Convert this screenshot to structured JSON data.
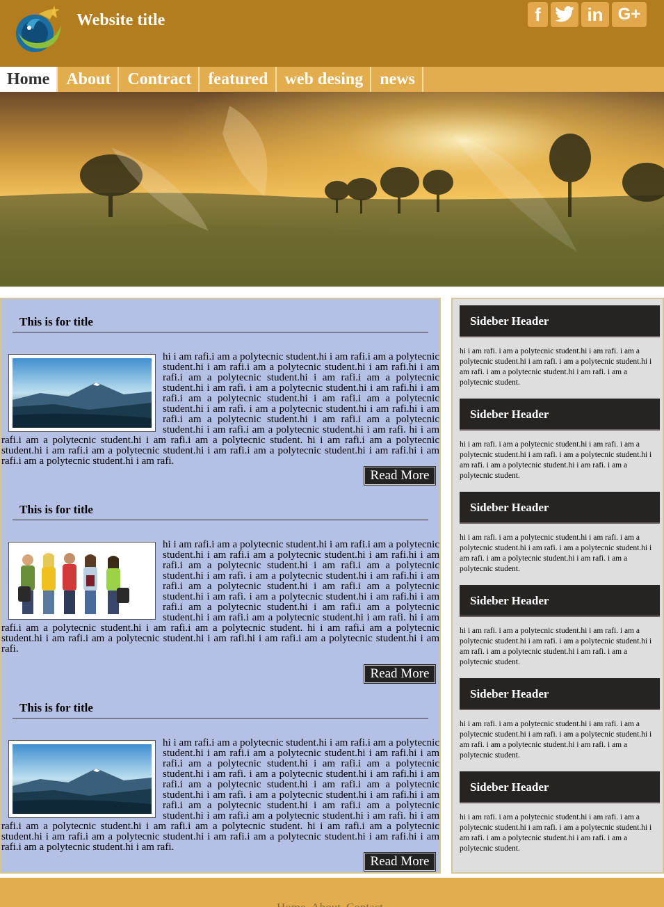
{
  "header": {
    "title": "Website title",
    "social": [
      "facebook-icon",
      "twitter-icon",
      "linkedin-icon",
      "google-plus-icon"
    ],
    "social_glyphs": {
      "facebook": "f",
      "twitter": "t",
      "linkedin": "in",
      "gplus": "G+"
    }
  },
  "nav": {
    "items": [
      {
        "label": "Home"
      },
      {
        "label": "About"
      },
      {
        "label": "Contract"
      },
      {
        "label": "featured"
      },
      {
        "label": "web desing"
      },
      {
        "label": "news"
      }
    ]
  },
  "articles": [
    {
      "title": "This is for title",
      "image": "mountain-landscape",
      "body": "hi i am rafi.i am a polytecnic student.hi i am rafi.i am a polytecnic student.hi i am rafi.i am a polytecnic student.hi i am rafi.hi i am rafi.i am a polytecnic student.hi i am rafi.i am a polytecnic student.hi i am rafi. i am a polytecnic student.hi i am rafi.hi i am rafi.i am a polytecnic student.hi i am rafi.i am a polytecnic student.hi i am rafi. i am a polytecnic student.hi i am rafi.hi i am rafi.i am a polytecnic student.hi i am rafi.i am a polytecnic student.hi i am rafi.i am a polytecnic student.hi i am rafi. hi i am rafi.i am a polytecnic student.hi i am rafi.i am a polytecnic student. hi i am rafi.i am a polytecnic student.hi i am rafi.i am a polytecnic student.hi i am rafi.i am a polytecnic student.hi i am rafi.hi i am rafi.i am a polytecnic student.hi i am rafi.",
      "read_more": "Read More"
    },
    {
      "title": "This is for title",
      "image": "students-group",
      "body": "hi i am rafi.i am a polytecnic student.hi i am rafi.i am a polytecnic student.hi i am rafi.i am a polytecnic student.hi i am rafi.hi i am rafi.i am a polytecnic student.hi i am rafi.i am a polytecnic student.hi i am rafi. i am a polytecnic student.hi i am rafi.hi i am rafi.i am a polytecnic student.hi i am rafi.i am a polytecnic student.hi i am rafi. i am a polytecnic student.hi i am rafi.hi i am rafi.i am a polytecnic student.hi i am rafi.i am a polytecnic student.hi i am rafi.i am a polytecnic student.hi i am rafi. hi i am rafi.i am a polytecnic student.hi i am rafi.i am a polytecnic student. hi i am rafi.i am a polytecnic student.hi i am rafi.i am a polytecnic student.hi i am rafi.hi i am rafi.i am a polytecnic student.hi i am rafi.",
      "read_more": "Read More"
    },
    {
      "title": "This is for title",
      "image": "mountain-landscape",
      "body": "hi i am rafi.i am a polytecnic student.hi i am rafi.i am a polytecnic student.hi i am rafi.i am a polytecnic student.hi i am rafi.hi i am rafi.i am a polytecnic student.hi i am rafi.i am a polytecnic student.hi i am rafi. i am a polytecnic student.hi i am rafi.hi i am rafi.i am a polytecnic student.hi i am rafi.i am a polytecnic student.hi i am rafi. i am a polytecnic student.hi i am rafi.hi i am rafi.i am a polytecnic student.hi i am rafi.i am a polytecnic student.hi i am rafi.i am a polytecnic student.hi i am rafi. hi i am rafi.i am a polytecnic student.hi i am rafi.i am a polytecnic student. hi i am rafi.i am a polytecnic student.hi i am rafi.i am a polytecnic student.hi i am rafi.i am a polytecnic student.hi i am rafi.hi i am rafi.i am a polytecnic student.hi i am rafi.",
      "read_more": "Read More"
    }
  ],
  "sidebar": {
    "blocks": [
      {
        "header": "Sideber Header",
        "text": "hi i am rafi. i am a polytecnic student.hi i am rafi. i am a polytecnic student.hi i am rafi. i am a polytecnic student.hi i am rafi. i am a polytecnic student.hi i am rafi. i am a polytecnic student."
      },
      {
        "header": "Sideber Header",
        "text": "hi i am rafi. i am a polytecnic student.hi i am rafi. i am a polytecnic student.hi i am rafi. i am a polytecnic student.hi i am rafi. i am a polytecnic student.hi i am rafi. i am a polytecnic student."
      },
      {
        "header": "Sideber Header",
        "text": "hi i am rafi. i am a polytecnic student.hi i am rafi. i am a polytecnic student.hi i am rafi. i am a polytecnic student.hi i am rafi. i am a polytecnic student.hi i am rafi. i am a polytecnic student."
      },
      {
        "header": "Sideber Header",
        "text": "hi i am rafi. i am a polytecnic student.hi i am rafi. i am a polytecnic student.hi i am rafi. i am a polytecnic student.hi i am rafi. i am a polytecnic student.hi i am rafi. i am a polytecnic student."
      },
      {
        "header": "Sideber Header",
        "text": "hi i am rafi. i am a polytecnic student.hi i am rafi. i am a polytecnic student.hi i am rafi. i am a polytecnic student.hi i am rafi. i am a polytecnic student.hi i am rafi. i am a polytecnic student."
      },
      {
        "header": "Sideber Header",
        "text": "hi i am rafi. i am a polytecnic student.hi i am rafi. i am a polytecnic student.hi i am rafi. i am a polytecnic student.hi i am rafi. i am a polytecnic student.hi i am rafi. i am a polytecnic student."
      }
    ]
  },
  "footer": {
    "links": [
      "Home",
      "About",
      "Contact"
    ]
  },
  "colors": {
    "header_bg": "#b37c1c",
    "nav_bg": "#e3ac4c",
    "main_bg": "#b4c0e4",
    "sidebar_bg": "#dedede",
    "dark": "#262323"
  }
}
